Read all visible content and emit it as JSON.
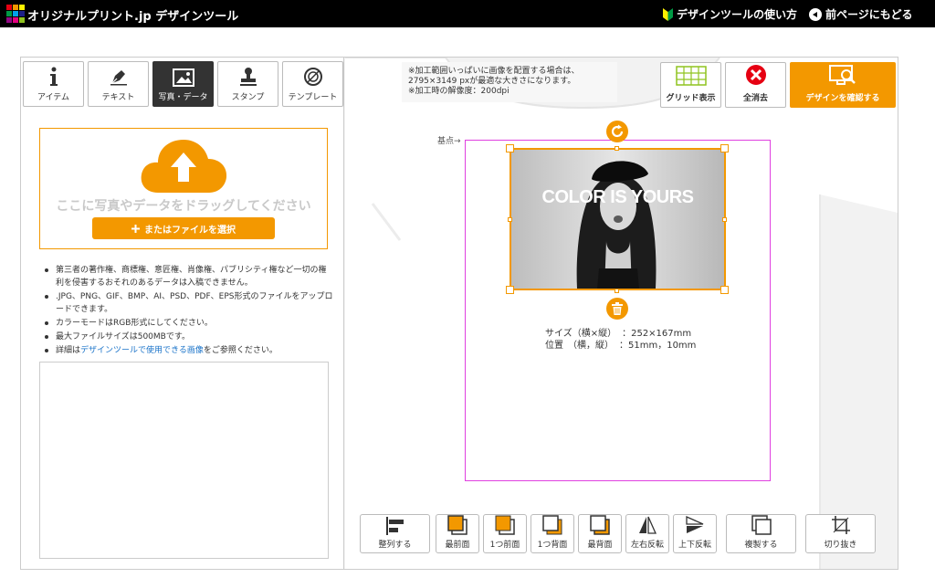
{
  "header": {
    "brand": "オリジナルプリント.jp デザインツール",
    "howto_link": "デザインツールの使い方",
    "back_link": "前ページにもどる"
  },
  "left_panel": {
    "tabs": [
      {
        "label": "アイテム",
        "icon": "info-icon"
      },
      {
        "label": "テキスト",
        "icon": "pen-icon"
      },
      {
        "label": "写真・データ",
        "icon": "image-icon",
        "active": true
      },
      {
        "label": "スタンプ",
        "icon": "stamp-icon"
      },
      {
        "label": "テンプレート",
        "icon": "template-icon"
      }
    ],
    "dropzone_text": "ここに写真やデータをドラッグしてください",
    "select_button": "またはファイルを選択",
    "notes": [
      "第三者の著作権、商標権、意匠権、肖像権、パブリシティ権など一切の権利を侵害するおそれのあるデータは入稿できません。",
      ".JPG、PNG、GIF、BMP、AI、PSD、PDF、EPS形式のファイルをアップロードできます。",
      "カラーモードはRGB形式にしてください。",
      "最大ファイルサイズは500MBです。"
    ],
    "detail_prefix": "詳細は",
    "detail_link": "デザインツールで使用できる画像",
    "detail_suffix": "をご参照ください。"
  },
  "canvas": {
    "info_lines": [
      "※加工範囲いっぱいに画像を配置する場合は、",
      "2795×3149 pxが最適な大きさになります。",
      "※加工時の解像度：200dpi"
    ],
    "grid_button": "グリッド表示",
    "clear_button": "全消去",
    "confirm_button": "デザインを確認する",
    "origin_label": "基点→",
    "image_text": "COLOR IS YOURS",
    "size_label": "サイズ（横×縦）",
    "size_value": "：252×167mm",
    "position_label": "位置　（横，縦）",
    "position_value": "：51mm，10mm"
  },
  "bottom_toolbar": {
    "align": "整列する",
    "front_most": "最前面",
    "forward": "1つ前面",
    "backward": "1つ背面",
    "back_most": "最背面",
    "flip_h": "左右反転",
    "flip_v": "上下反転",
    "duplicate": "複製する",
    "crop": "切り抜き"
  },
  "colors": {
    "accent": "#f39800",
    "print_area": "#e040e0"
  }
}
